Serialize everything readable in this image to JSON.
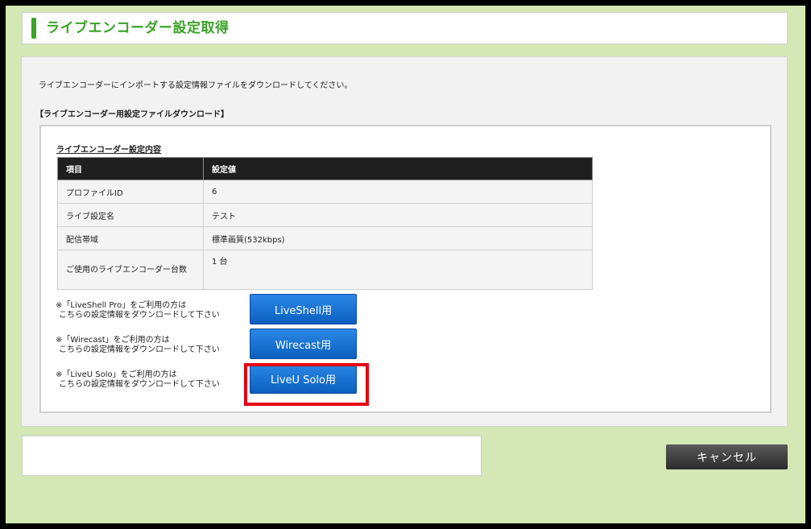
{
  "header": {
    "title": "ライブエンコーダー設定取得"
  },
  "intro_text": "ライブエンコーダーにインポートする設定情報ファイルをダウンロードしてください。",
  "section_title": "【ライブエンコーダー用設定ファイルダウンロード】",
  "settings_table": {
    "caption": "ライブエンコーダー設定内容",
    "headers": [
      "項目",
      "設定値"
    ],
    "rows": [
      [
        "プロファイルID",
        "6"
      ],
      [
        "ライブ設定名",
        "テスト"
      ],
      [
        "配信帯域",
        "標準画質(532kbps)"
      ],
      [
        "ご使用のライブエンコーダー台数",
        "1 台"
      ]
    ]
  },
  "downloads": [
    {
      "note_line1": "※「LiveShell Pro」をご利用の方は",
      "note_line2": "こちらの設定情報をダウンロードして下さい",
      "button_label": "LiveShell用"
    },
    {
      "note_line1": "※「Wirecast」をご利用の方は",
      "note_line2": "こちらの設定情報をダウンロードして下さい",
      "button_label": "Wirecast用"
    },
    {
      "note_line1": "※「LiveU Solo」をご利用の方は",
      "note_line2": "こちらの設定情報をダウンロードして下さい",
      "button_label": "LiveU Solo用"
    }
  ],
  "cancel_label": "キャンセル",
  "colors": {
    "accent_green": "#3aa328",
    "button_blue": "#1a73d6",
    "highlight_red": "#e60012"
  }
}
